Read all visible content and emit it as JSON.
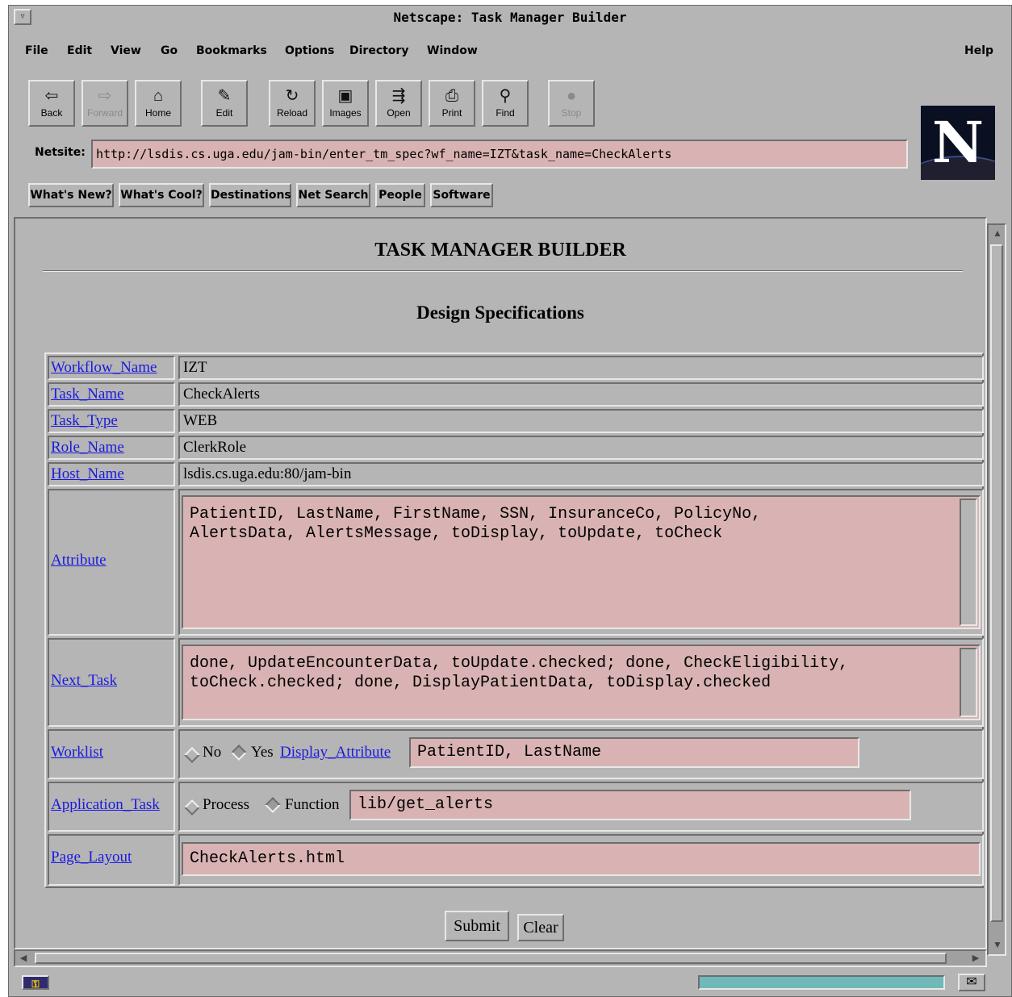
{
  "window": {
    "title": "Netscape: Task Manager Builder",
    "sys_icon": "▿"
  },
  "menu": {
    "file": "File",
    "edit": "Edit",
    "view": "View",
    "go": "Go",
    "bookmarks": "Bookmarks",
    "options": "Options",
    "directory": "Directory",
    "window": "Window",
    "help": "Help"
  },
  "toolbar": {
    "back": {
      "label": "Back",
      "icon": "⇦"
    },
    "forward": {
      "label": "Forward",
      "icon": "⇨"
    },
    "home": {
      "label": "Home",
      "icon": "⌂"
    },
    "edit": {
      "label": "Edit",
      "icon": "✎"
    },
    "reload": {
      "label": "Reload",
      "icon": "↻"
    },
    "images": {
      "label": "Images",
      "icon": "▣"
    },
    "open": {
      "label": "Open",
      "icon": "⇶"
    },
    "print": {
      "label": "Print",
      "icon": "⎙"
    },
    "find": {
      "label": "Find",
      "icon": "⚲"
    },
    "stop": {
      "label": "Stop",
      "icon": "●"
    }
  },
  "logo": {
    "letter": "N"
  },
  "location": {
    "label": "Netsite:",
    "url": "http://lsdis.cs.uga.edu/jam-bin/enter_tm_spec?wf_name=IZT&task_name=CheckAlerts"
  },
  "directory_buttons": {
    "whats_new": "What's New?",
    "whats_cool": "What's Cool?",
    "destinations": "Destinations",
    "net_search": "Net Search",
    "people": "People",
    "software": "Software"
  },
  "page": {
    "title": "TASK MANAGER BUILDER",
    "subtitle": "Design Specifications"
  },
  "spec": {
    "workflow_name": {
      "label": "Workflow_Name",
      "value": "IZT"
    },
    "task_name": {
      "label": "Task_Name",
      "value": "CheckAlerts"
    },
    "task_type": {
      "label": "Task_Type",
      "value": "WEB"
    },
    "role_name": {
      "label": "Role_Name",
      "value": "ClerkRole"
    },
    "host_name": {
      "label": "Host_Name",
      "value": "lsdis.cs.uga.edu:80/jam-bin"
    },
    "attribute": {
      "label": "Attribute",
      "value": "PatientID, LastName, FirstName, SSN, InsuranceCo, PolicyNo,\nAlertsData, AlertsMessage, toDisplay, toUpdate, toCheck"
    },
    "next_task": {
      "label": "Next_Task",
      "value": "done, UpdateEncounterData, toUpdate.checked; done, CheckEligibility,\ntoCheck.checked; done, DisplayPatientData, toDisplay.checked"
    },
    "worklist": {
      "label": "Worklist",
      "no_label": "No",
      "yes_label": "Yes",
      "selected": "Yes",
      "display_attribute_label": "Display_Attribute",
      "display_attribute_value": "PatientID, LastName"
    },
    "application_task": {
      "label": "Application_Task",
      "process_label": "Process",
      "function_label": "Function",
      "selected": "Function",
      "value": "lib/get_alerts"
    },
    "page_layout": {
      "label": "Page_Layout",
      "value": "CheckAlerts.html"
    }
  },
  "form": {
    "submit": "Submit",
    "clear": "Clear"
  },
  "status": {
    "security_icon": "key-icon",
    "mail_icon": "mail-icon",
    "progress": 1.0
  }
}
